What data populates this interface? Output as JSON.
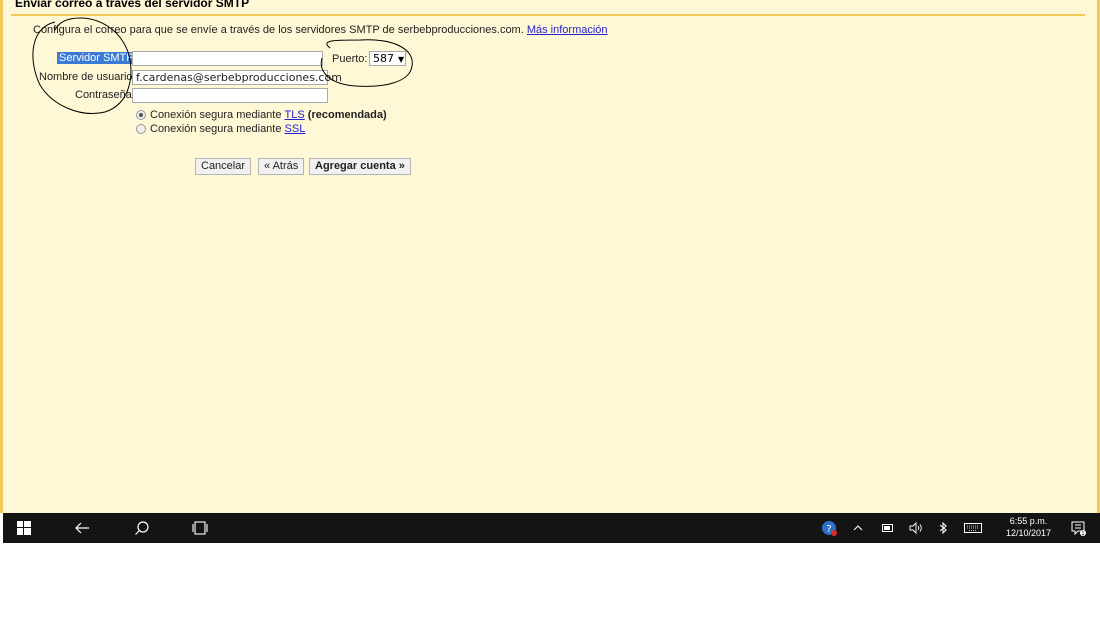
{
  "page": {
    "title": "Enviar correo a través del servidor SMTP",
    "intro_text": "Configura el correo para que se envíe a través de los servidores SMTP de serbebproducciones.com.",
    "more_info_link": "Más información"
  },
  "form": {
    "smtp_label": "Servidor SMTP",
    "smtp_value": "",
    "username_label": "Nombre de usuario:",
    "username_value": "f.cardenas@serbebproducciones.com",
    "password_label": "Contraseña:",
    "password_value": "",
    "port_label": "Puerto:",
    "port_value": "587",
    "tls_option_prefix": "Conexión segura mediante",
    "tls_link": "TLS",
    "tls_recommended": "(recomendada)",
    "ssl_option_prefix": "Conexión segura mediante",
    "ssl_link": "SSL",
    "selected_option": "TLS"
  },
  "buttons": {
    "cancel": "Cancelar",
    "back": "« Atrás",
    "add_account": "Agregar cuenta »"
  },
  "taskbar": {
    "time": "6:55 p.m.",
    "date": "12/10/2017",
    "icons": [
      "windows-start-icon",
      "back-arrow-icon",
      "search-icon",
      "task-view-icon",
      "help-icon",
      "chevron-up-icon",
      "battery-icon",
      "volume-icon",
      "bluetooth-icon",
      "keyboard-icon",
      "notification-icon"
    ]
  },
  "colors": {
    "background": "#fff8d6",
    "border": "#f3c85a",
    "link": "#2222cc",
    "selection": "#3a7bd5",
    "taskbar": "#141414"
  }
}
